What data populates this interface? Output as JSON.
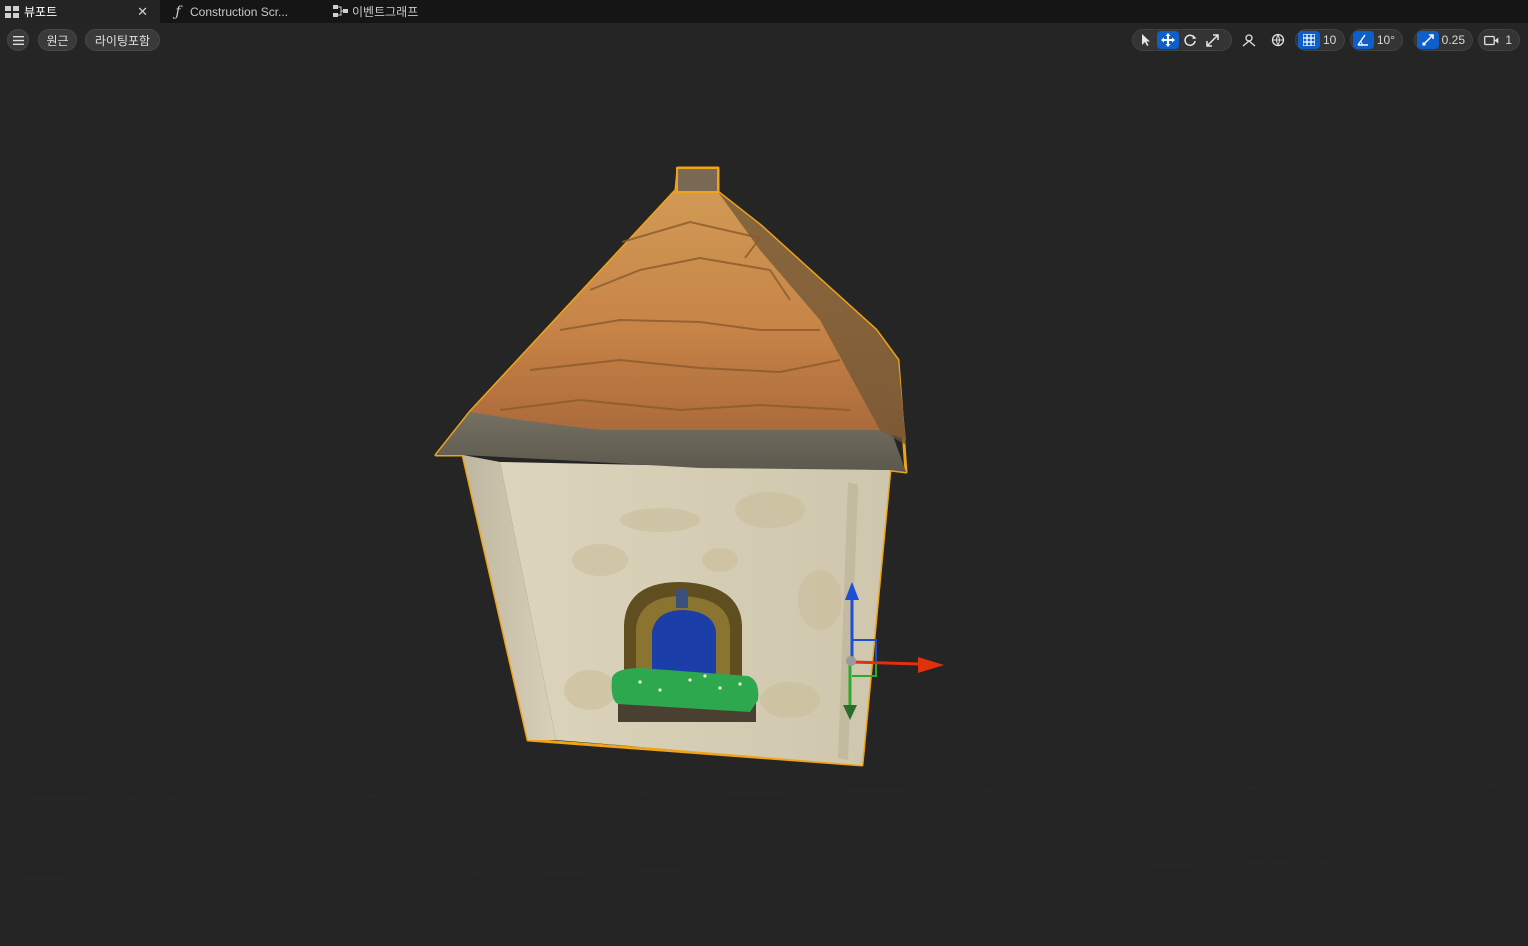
{
  "tabs": [
    {
      "label": "뷰포트",
      "icon": "viewport-grid-icon",
      "active": true
    },
    {
      "label": "Construction Scr...",
      "icon": "function-icon",
      "active": false
    },
    {
      "label": "이벤트그래프",
      "icon": "graph-nodes-icon",
      "active": false
    }
  ],
  "viewport_toolbar": {
    "menu_icon": "hamburger-menu-icon",
    "view_mode_label": "원근",
    "lighting_label": "라이팅포함",
    "transform_tools": [
      "select-arrow-icon",
      "move-icon",
      "rotate-icon",
      "scale-icon"
    ],
    "active_tool": "move-icon",
    "surface_snap_icon": "surface-snap-icon",
    "world_local_icon": "world-local-icon",
    "grid_snap_value": "10",
    "rotation_snap_value": "10°",
    "scale_snap_value": "0.25",
    "camera_speed_value": "1"
  },
  "colors": {
    "accent": "#0e5fc9",
    "selection_outline": "#f0a316",
    "gizmo_x": "#e0300e",
    "gizmo_y": "#2ea82e",
    "gizmo_z": "#1d4fd6"
  }
}
